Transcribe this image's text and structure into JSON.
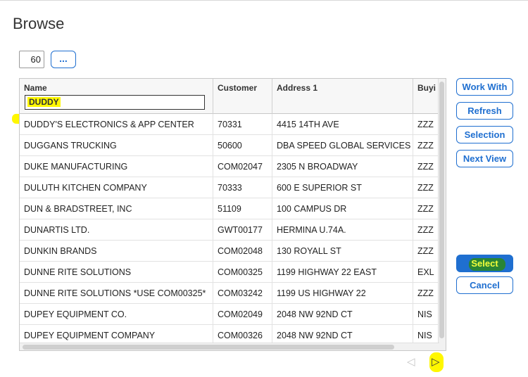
{
  "page": {
    "title": "Browse"
  },
  "toolbar": {
    "count": "60",
    "more_label": "..."
  },
  "grid": {
    "columns": [
      "Name",
      "Customer",
      "Address 1",
      "Buyi"
    ],
    "filter_value": "DUDDY",
    "rows": [
      [
        "DUDDY'S ELECTRONICS & APP CENTER",
        "70331",
        "4415 14TH AVE",
        "ZZZ"
      ],
      [
        "DUGGANS TRUCKING",
        "50600",
        "DBA SPEED GLOBAL SERVICES",
        "ZZZ"
      ],
      [
        "DUKE MANUFACTURING",
        "COM02047",
        "2305 N BROADWAY",
        "ZZZ"
      ],
      [
        "DULUTH KITCHEN COMPANY",
        "70333",
        "600 E SUPERIOR ST",
        "ZZZ"
      ],
      [
        "DUN & BRADSTREET, INC",
        "51109",
        "100 CAMPUS DR",
        "ZZZ"
      ],
      [
        "DUNARTIS LTD.",
        "GWT00177",
        "HERMINA U.74A.",
        "ZZZ"
      ],
      [
        "DUNKIN BRANDS",
        "COM02048",
        "130 ROYALL ST",
        "ZZZ"
      ],
      [
        "DUNNE RITE SOLUTIONS",
        "COM00325",
        "1199 HIGHWAY 22 EAST",
        "EXL"
      ],
      [
        "DUNNE RITE SOLUTIONS *USE COM00325*",
        "COM03242",
        "1199 US HIGHWAY 22",
        "ZZZ"
      ],
      [
        "DUPEY EQUIPMENT CO.",
        "COM02049",
        "2048 NW 92ND CT",
        "NIS"
      ],
      [
        "DUPEY EQUIPMENT COMPANY",
        "COM00326",
        "2048 NW 92ND CT",
        "NIS"
      ]
    ]
  },
  "actions": {
    "work_with": "Work With",
    "refresh": "Refresh",
    "selection": "Selection",
    "next_view": "Next View",
    "select": "Select",
    "cancel": "Cancel"
  },
  "pager": {
    "prev_icon": "triangle-left-icon",
    "next_icon": "triangle-right-icon"
  },
  "colors": {
    "accent": "#1f6fd0",
    "highlight": "#fff700"
  }
}
